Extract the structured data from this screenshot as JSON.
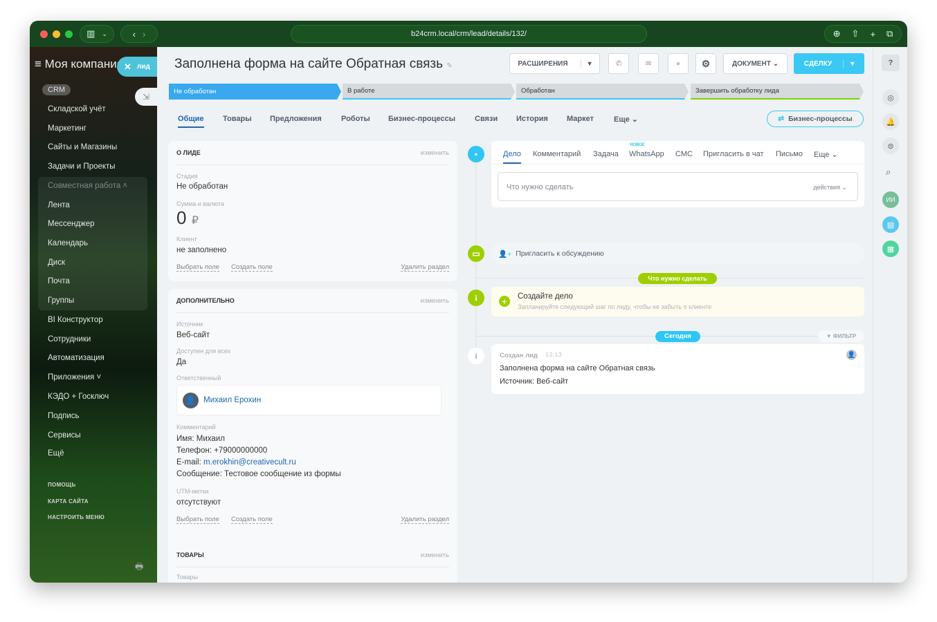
{
  "browser": {
    "url": "b24crm.local/crm/lead/details/132/"
  },
  "sidebar": {
    "company": "Моя компания",
    "lead_badge": "лид",
    "crm": "CRM",
    "items": [
      "Складской учёт",
      "Маркетинг",
      "Сайты и Магазины",
      "Задачи и Проекты"
    ],
    "group_title": "Совместная работа",
    "group_items": [
      "Лента",
      "Мессенджер",
      "Календарь",
      "Диск",
      "Почта",
      "Группы"
    ],
    "items2": [
      "BI Конструктор",
      "Сотрудники",
      "Автоматизация",
      "Приложения",
      "КЭДО + Госключ",
      "Подпись",
      "Сервисы",
      "Ещё"
    ],
    "footer": [
      "ПОМОЩЬ",
      "КАРТА САЙТА",
      "НАСТРОИТЬ МЕНЮ"
    ]
  },
  "header": {
    "title": "Заполнена форма на сайте Обратная связь",
    "extensions": "РАСШИРЕНИЯ",
    "document": "ДОКУМЕНТ",
    "deal": "СДЕЛКУ"
  },
  "stages": [
    "Не обработан",
    "В работе",
    "Обработан",
    "Завершить обработку лида"
  ],
  "tabs": [
    "Общие",
    "Товары",
    "Предложения",
    "Роботы",
    "Бизнес-процессы",
    "Связи",
    "История",
    "Маркет",
    "Еще"
  ],
  "bp_button": "Бизнес-процессы",
  "about": {
    "title": "О ЛИДЕ",
    "edit": "изменить",
    "stage_label": "Стадия",
    "stage": "Не обработан",
    "sum_label": "Сумма и валюта",
    "sum": "0",
    "currency": "₽",
    "client_label": "Клиент",
    "client": "не заполнено",
    "select_field": "Выбрать поле",
    "create_field": "Создать поле",
    "delete_section": "Удалить раздел"
  },
  "extra": {
    "title": "ДОПОЛНИТЕЛЬНО",
    "edit": "изменить",
    "source_label": "Источник",
    "source": "Веб-сайт",
    "public_label": "Доступен для всех",
    "public": "Да",
    "resp_label": "Ответственный",
    "resp": "Михаил Ерохин",
    "comment_label": "Комментарий",
    "c_name": "Имя: Михаил",
    "c_phone": "Телефон: +79000000000",
    "c_email_prefix": "E-mail: ",
    "c_email": "m.erokhin@creativecult.ru",
    "c_msg": "Сообщение: Тестовое сообщение из формы",
    "utm_label": "UTM-метки",
    "utm": "отсутствуют",
    "select_field": "Выбрать поле",
    "create_field": "Создать поле",
    "delete_section": "Удалить раздел"
  },
  "products": {
    "title": "ТОВАРЫ",
    "edit": "изменить",
    "label": "Товары"
  },
  "timeline": {
    "tabs": [
      "Дело",
      "Комментарий",
      "Задача",
      "WhatsApp",
      "СМС",
      "Пригласить в чат",
      "Письмо",
      "Еще"
    ],
    "new_badge": "НОВОЕ",
    "placeholder": "Что нужно сделать",
    "actions": "действия",
    "invite": "Пригласить к обсуждению",
    "todo_badge": "Что нужно сделать",
    "create_title": "Создайте дело",
    "create_sub": "Запланируйте следующий шаг по лиду, чтобы не забыть о клиенте",
    "today": "Сегодня",
    "filter": "ФИЛЬТР",
    "event_title": "Создан лид",
    "event_time": "13:13",
    "event_line1": "Заполнена форма на сайте Обратная связь",
    "event_line2": "Источник: Веб-сайт"
  },
  "rightbar": {
    "ai": "ИИ"
  }
}
